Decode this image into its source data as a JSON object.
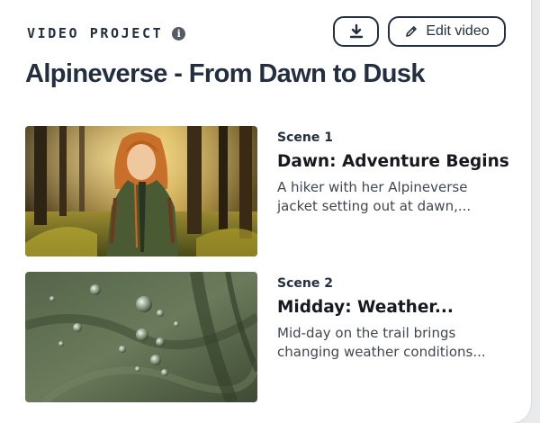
{
  "header": {
    "eyebrow": "VIDEO PROJECT",
    "info_icon": "info-icon",
    "download_icon": "download-icon",
    "edit_icon": "pencil-icon",
    "edit_label": "Edit video"
  },
  "project": {
    "title": "Alpineverse - From Dawn to Dusk"
  },
  "scenes": [
    {
      "number": "Scene 1",
      "title": "Dawn: Adventure Begins",
      "description_line1": "A hiker with her Alpineverse",
      "description_line2": "jacket setting out at dawn,..."
    },
    {
      "number": "Scene 2",
      "title": "Midday: Weather...",
      "description_line1": "Mid-day on the trail brings",
      "description_line2": "changing weather conditions..."
    }
  ],
  "colors": {
    "text_primary": "#232f3e",
    "text_secondary": "#414750",
    "page_background": "#e9eaec"
  }
}
